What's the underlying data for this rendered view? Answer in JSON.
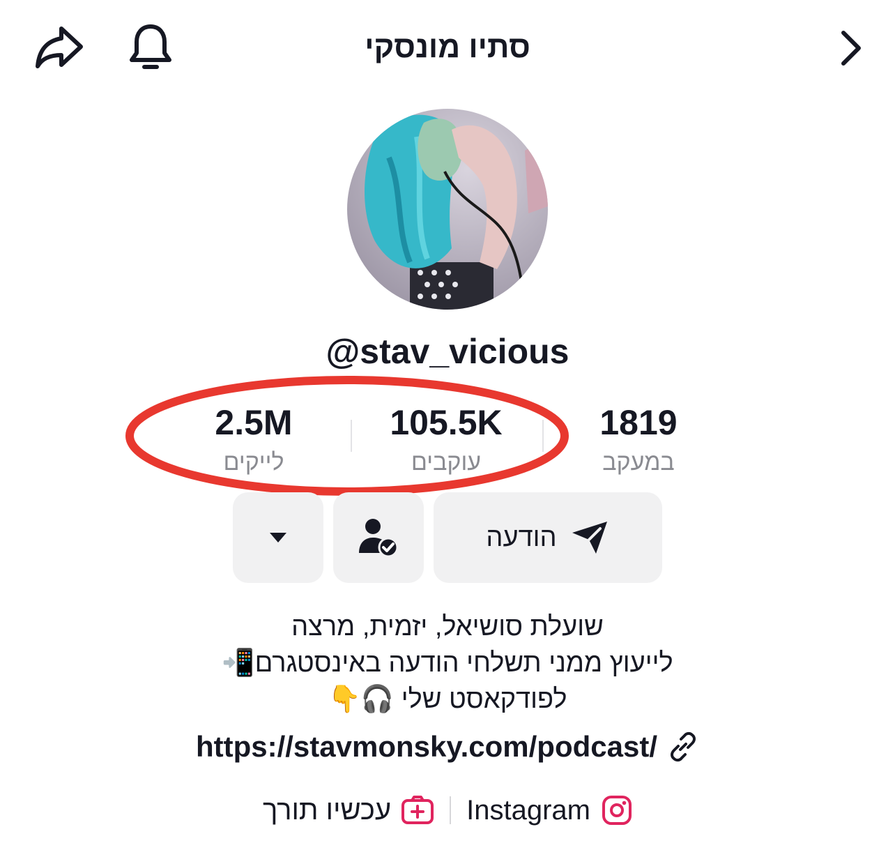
{
  "header": {
    "title": "סתיו מונסקי",
    "share_icon": "share-arrow-icon",
    "bell_icon": "bell-icon",
    "back_icon": "chevron-right-icon"
  },
  "profile": {
    "username": "@stav_vicious"
  },
  "stats": {
    "following": {
      "value": "1819",
      "label": "במעקב"
    },
    "followers": {
      "value": "105.5K",
      "label": "עוקבים"
    },
    "likes": {
      "value": "2.5M",
      "label": "לייקים"
    }
  },
  "actions": {
    "message_label": "הודעה",
    "message_icon": "send-plane-icon",
    "friend_icon": "user-check-icon",
    "more_icon": "caret-down-icon"
  },
  "bio": {
    "line1": "שועלת סושיאל, יזמית, מרצה",
    "line2": "לייעוץ ממני תשלחי הודעה באינסטגרם📲",
    "line3": "לפודקאסט שלי 🎧👇"
  },
  "link": {
    "url": "https://stavmonsky.com/podcast/",
    "icon": "link-icon"
  },
  "social": {
    "instagram_label": "Instagram",
    "edit_label": "עכשיו תורך",
    "instagram_icon": "instagram-icon",
    "add_icon": "add-video-icon"
  },
  "colors": {
    "text": "#161823",
    "muted": "#8a8b91",
    "button_bg": "#f1f1f2",
    "highlight_circle": "#e8382f",
    "brand_pink": "#e0245e"
  }
}
